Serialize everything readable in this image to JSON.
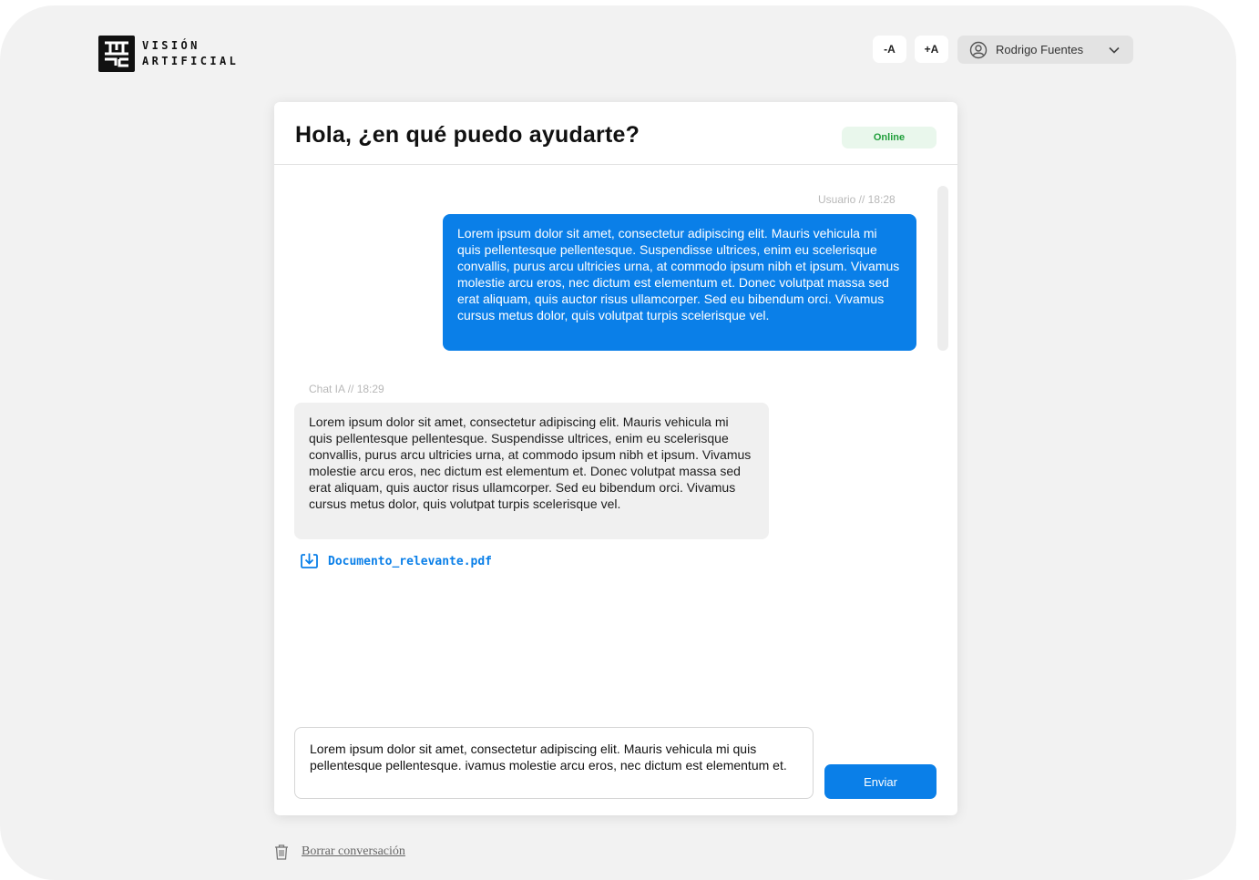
{
  "brand": {
    "line1": "VISIÓN",
    "line2": "ARTIFICIAL",
    "logo_icon": "vision-artificial-logo"
  },
  "header": {
    "font_decrease_label": "-A",
    "font_increase_label": "+A",
    "user_name": "Rodrigo Fuentes",
    "user_icon": "user-circle-icon",
    "menu_icon": "chevron-down-icon"
  },
  "chat": {
    "title": "Hola, ¿en qué puedo ayudarte?",
    "status": "Online",
    "colors": {
      "accent": "#0a7fe8",
      "status_bg": "#e9f7ec",
      "status_text": "#1f9e3a"
    },
    "messages": [
      {
        "meta": "Usuario // 18:28",
        "text": "Lorem ipsum dolor sit amet, consectetur adipiscing elit. Mauris vehicula mi quis pellentesque pellentesque. Suspendisse ultrices, enim eu scelerisque convallis, purus arcu ultricies urna, at commodo ipsum nibh et ipsum. Vivamus molestie arcu eros, nec dictum est elementum et. Donec volutpat massa sed erat aliquam, quis auctor risus ullamcorper. Sed eu bibendum orci. Vivamus cursus metus dolor, quis volutpat turpis scelerisque vel."
      },
      {
        "meta": "Chat IA // 18:29",
        "text": "Lorem ipsum dolor sit amet, consectetur adipiscing elit. Mauris vehicula mi quis pellentesque pellentesque. Suspendisse ultrices, enim eu scelerisque convallis, purus arcu ultricies urna, at commodo ipsum nibh et ipsum. Vivamus molestie arcu eros, nec dictum est elementum et. Donec volutpat massa sed erat aliquam, quis auctor risus ullamcorper. Sed eu bibendum orci. Vivamus cursus metus dolor, quis volutpat turpis scelerisque vel."
      }
    ],
    "attachment": {
      "filename": "Documento_relevante.pdf",
      "icon": "download-icon"
    },
    "composer_value": "Lorem ipsum dolor sit amet, consectetur adipiscing elit. Mauris vehicula mi quis pellentesque pellentesque. ivamus molestie arcu eros, nec dictum est elementum et.",
    "send_label": "Enviar"
  },
  "footer": {
    "clear_label": "Borrar conversación",
    "clear_icon": "trash-icon"
  }
}
